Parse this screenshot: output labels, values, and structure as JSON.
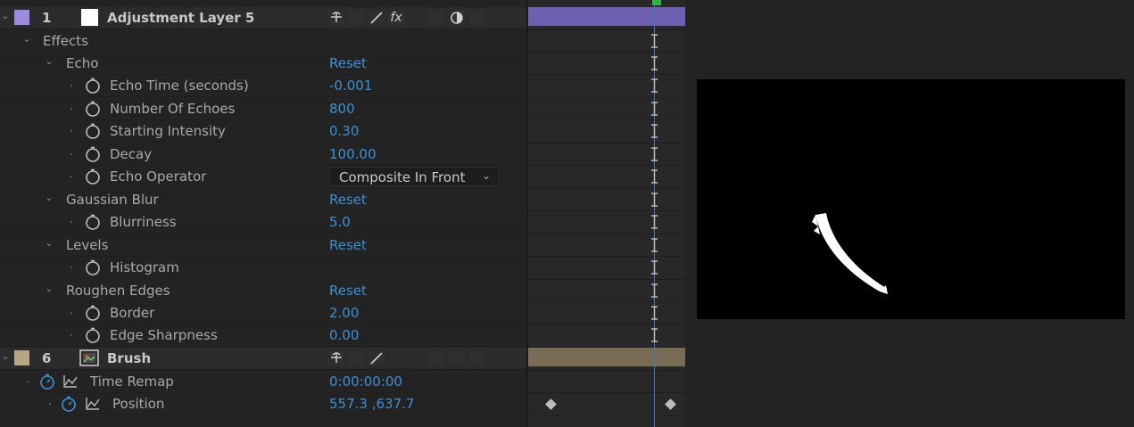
{
  "layers": [
    {
      "number": "1",
      "name": "Adjustment Layer 5",
      "label_color": "#9b8ae0",
      "bar_color": "#6e5fb0"
    },
    {
      "number": "6",
      "name": "Brush",
      "label_color": "#b8a584",
      "bar_color": "#7a6b54"
    }
  ],
  "effects_group": "Effects",
  "effects": [
    {
      "name": "Echo",
      "reset": "Reset",
      "props": [
        {
          "name": "Echo Time (seconds)",
          "value": "-0.001"
        },
        {
          "name": "Number Of Echoes",
          "value": "800"
        },
        {
          "name": "Starting Intensity",
          "value": "0.30"
        },
        {
          "name": "Decay",
          "value": "100.00"
        },
        {
          "name": "Echo Operator",
          "value": "Composite In Front",
          "type": "dropdown"
        }
      ]
    },
    {
      "name": "Gaussian Blur",
      "reset": "Reset",
      "props": [
        {
          "name": "Blurriness",
          "value": "5.0"
        }
      ]
    },
    {
      "name": "Levels",
      "reset": "Reset",
      "props": [
        {
          "name": "Histogram",
          "value": ""
        }
      ]
    },
    {
      "name": "Roughen Edges",
      "reset": "Reset",
      "props": [
        {
          "name": "Border",
          "value": "2.00"
        },
        {
          "name": "Edge Sharpness",
          "value": "0.00"
        }
      ]
    }
  ],
  "brush_props": [
    {
      "name": "Time Remap",
      "value": "0:00:00:00"
    },
    {
      "name": "Position",
      "value": "557.3 ,637.7"
    }
  ],
  "colors": {
    "value_blue": "#3d8fd6",
    "playhead": "#3e7bd0",
    "canvas": "#000000"
  }
}
